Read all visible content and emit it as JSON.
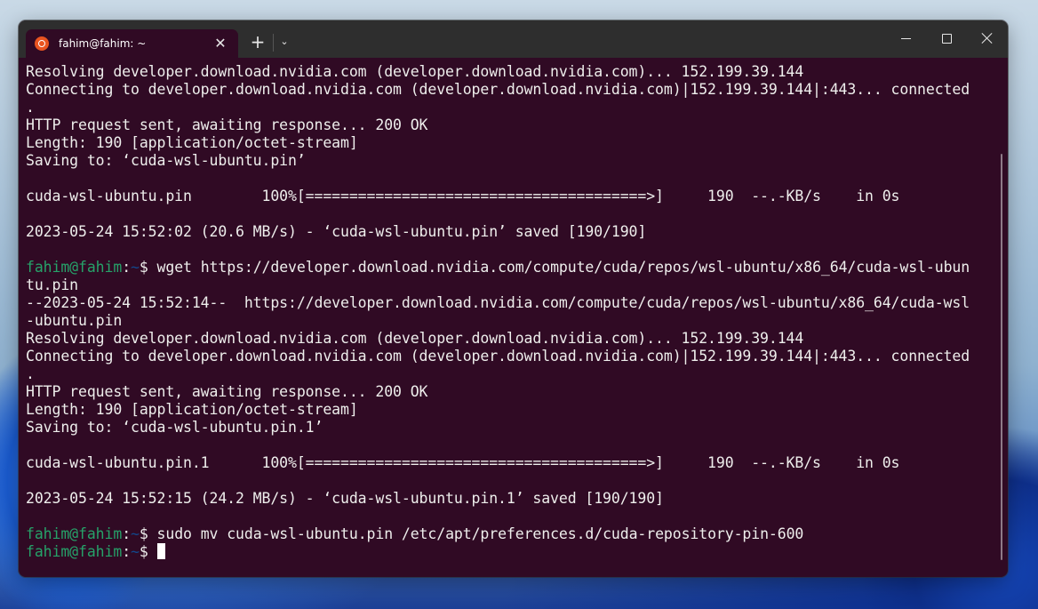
{
  "window": {
    "tab_title": "fahim@fahim: ~",
    "tab_icon": "ubuntu-logo-icon",
    "close_tab_glyph": "✕",
    "new_tab_glyph": "+",
    "dropdown_glyph": "⌄",
    "controls": [
      "minimize",
      "maximize",
      "close"
    ]
  },
  "colors": {
    "terminal_bg": "#300a24",
    "text": "#eeeeec",
    "prompt_user": "#26a269",
    "prompt_path": "#12488b",
    "titlebar": "#2e2e2e",
    "ubuntu_orange": "#e95420"
  },
  "prompt": {
    "user_host": "fahim@fahim",
    "colon": ":",
    "path": "~",
    "dollar": "$ "
  },
  "terminal": {
    "lines": [
      {
        "type": "text",
        "text": "Resolving developer.download.nvidia.com (developer.download.nvidia.com)... 152.199.39.144"
      },
      {
        "type": "text",
        "text": "Connecting to developer.download.nvidia.com (developer.download.nvidia.com)|152.199.39.144|:443... connected"
      },
      {
        "type": "text",
        "text": "."
      },
      {
        "type": "text",
        "text": "HTTP request sent, awaiting response... 200 OK"
      },
      {
        "type": "text",
        "text": "Length: 190 [application/octet-stream]"
      },
      {
        "type": "text",
        "text": "Saving to: ‘cuda-wsl-ubuntu.pin’"
      },
      {
        "type": "text",
        "text": ""
      },
      {
        "type": "text",
        "text": "cuda-wsl-ubuntu.pin        100%[=======================================>]     190  --.-KB/s    in 0s"
      },
      {
        "type": "text",
        "text": ""
      },
      {
        "type": "text",
        "text": "2023-05-24 15:52:02 (20.6 MB/s) - ‘cuda-wsl-ubuntu.pin’ saved [190/190]"
      },
      {
        "type": "text",
        "text": ""
      },
      {
        "type": "prompt",
        "command": "wget https://developer.download.nvidia.com/compute/cuda/repos/wsl-ubuntu/x86_64/cuda-wsl-ubun"
      },
      {
        "type": "text",
        "text": "tu.pin"
      },
      {
        "type": "text",
        "text": "--2023-05-24 15:52:14--  https://developer.download.nvidia.com/compute/cuda/repos/wsl-ubuntu/x86_64/cuda-wsl"
      },
      {
        "type": "text",
        "text": "-ubuntu.pin"
      },
      {
        "type": "text",
        "text": "Resolving developer.download.nvidia.com (developer.download.nvidia.com)... 152.199.39.144"
      },
      {
        "type": "text",
        "text": "Connecting to developer.download.nvidia.com (developer.download.nvidia.com)|152.199.39.144|:443... connected"
      },
      {
        "type": "text",
        "text": "."
      },
      {
        "type": "text",
        "text": "HTTP request sent, awaiting response... 200 OK"
      },
      {
        "type": "text",
        "text": "Length: 190 [application/octet-stream]"
      },
      {
        "type": "text",
        "text": "Saving to: ‘cuda-wsl-ubuntu.pin.1’"
      },
      {
        "type": "text",
        "text": ""
      },
      {
        "type": "text",
        "text": "cuda-wsl-ubuntu.pin.1      100%[=======================================>]     190  --.-KB/s    in 0s"
      },
      {
        "type": "text",
        "text": ""
      },
      {
        "type": "text",
        "text": "2023-05-24 15:52:15 (24.2 MB/s) - ‘cuda-wsl-ubuntu.pin.1’ saved [190/190]"
      },
      {
        "type": "text",
        "text": ""
      },
      {
        "type": "prompt",
        "command": "sudo mv cuda-wsl-ubuntu.pin /etc/apt/preferences.d/cuda-repository-pin-600"
      },
      {
        "type": "prompt",
        "command": "",
        "cursor": true
      }
    ]
  }
}
